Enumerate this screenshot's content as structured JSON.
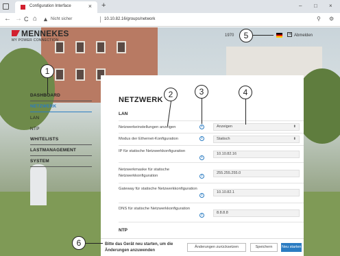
{
  "browser": {
    "tab_title": "Configuration Interface",
    "tab_close": "×",
    "new_tab": "+",
    "win_min": "–",
    "win_max": "□",
    "win_close": "×",
    "nav_back": "←",
    "nav_forward": "→",
    "nav_reload": "C",
    "nav_home": "⌂",
    "warning_icon": "▲",
    "insecure_label": "Nicht sicher",
    "url": "10.10.82.16/groups/network",
    "search_icon": "⚲",
    "ext_icon": "⚙"
  },
  "header": {
    "logo_text": "MENNEKES",
    "logo_sub": "MY POWER CONNECTION",
    "serial": "1970",
    "logout_label": "Abmelden"
  },
  "sidebar": {
    "items": [
      {
        "label": "DASHBOARD"
      },
      {
        "label": "NETZWERK"
      },
      {
        "label": "LAN"
      },
      {
        "label": "NTP"
      },
      {
        "label": "WHITELISTS"
      },
      {
        "label": "LASTMANAGEMENT"
      },
      {
        "label": "SYSTEM"
      }
    ]
  },
  "main": {
    "title": "NETZWERK",
    "section_lan": "LAN",
    "section_ntp": "NTP",
    "info_glyph": "i",
    "rows": [
      {
        "label": "Netzwerkeinstellungen anzeigen",
        "value": "Anzeigen"
      },
      {
        "label": "Modus der Ethernet-Konfiguration",
        "value": "Statisch"
      },
      {
        "label": "IP für statische Netzwerkkonfiguration",
        "value": "10.10.82.16"
      },
      {
        "label": "Netzwerkmaske für statische Netzwerkkonfiguration",
        "value": "255.255.255.0"
      },
      {
        "label": "Gateway für statische Netzwerkkonfiguration",
        "value": "10.10.82.1"
      },
      {
        "label": "DNS für statische Netzwerkkonfiguration",
        "value": "8.8.8.8"
      }
    ],
    "select_caret": "⬍"
  },
  "footer": {
    "message": "Bitte das Gerät neu starten, um die Änderungen anzuwenden",
    "reset_label": "Änderungen zurücksetzen",
    "save_label": "Speichern",
    "restart_label": "Neu starten"
  },
  "callouts": [
    "1",
    "2",
    "3",
    "4",
    "5",
    "6"
  ],
  "colors": {
    "accent": "#2b7cc2",
    "brand_red": "#d2202f"
  }
}
